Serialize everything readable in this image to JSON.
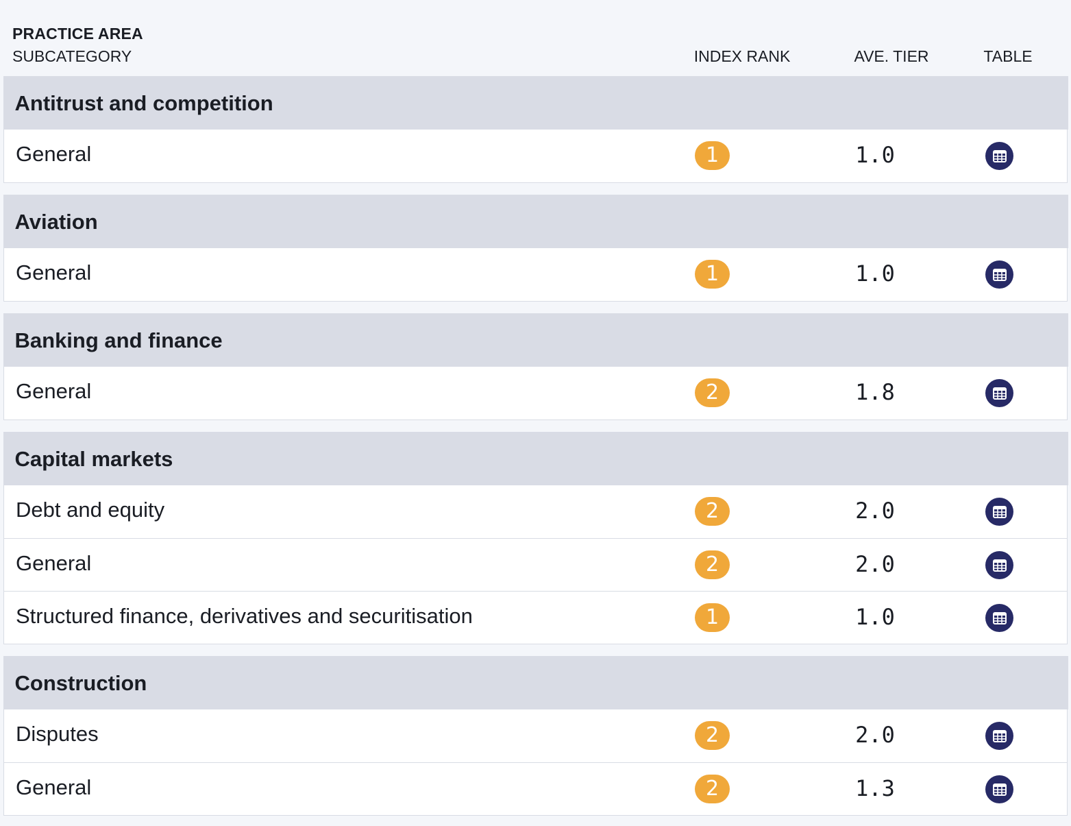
{
  "header": {
    "practice_area": "PRACTICE AREA",
    "subcategory": "SUBCATEGORY",
    "index_rank": "INDEX RANK",
    "ave_tier": "AVE. TIER",
    "table": "TABLE"
  },
  "icons": {
    "table_icon": "table-icon",
    "table_icon_color": "#272a66",
    "rank_badge_color": "#f0a83a"
  },
  "groups": [
    {
      "title": "Antitrust and competition",
      "rows": [
        {
          "label": "General",
          "rank": "1",
          "tier": "1.0"
        }
      ]
    },
    {
      "title": "Aviation",
      "rows": [
        {
          "label": "General",
          "rank": "1",
          "tier": "1.0"
        }
      ]
    },
    {
      "title": "Banking and finance",
      "rows": [
        {
          "label": "General",
          "rank": "2",
          "tier": "1.8"
        }
      ]
    },
    {
      "title": "Capital markets",
      "rows": [
        {
          "label": "Debt and equity",
          "rank": "2",
          "tier": "2.0"
        },
        {
          "label": "General",
          "rank": "2",
          "tier": "2.0"
        },
        {
          "label": "Structured finance, derivatives and securitisation",
          "rank": "1",
          "tier": "1.0"
        }
      ]
    },
    {
      "title": "Construction",
      "rows": [
        {
          "label": "Disputes",
          "rank": "2",
          "tier": "2.0"
        },
        {
          "label": "General",
          "rank": "2",
          "tier": "1.3"
        }
      ]
    }
  ]
}
